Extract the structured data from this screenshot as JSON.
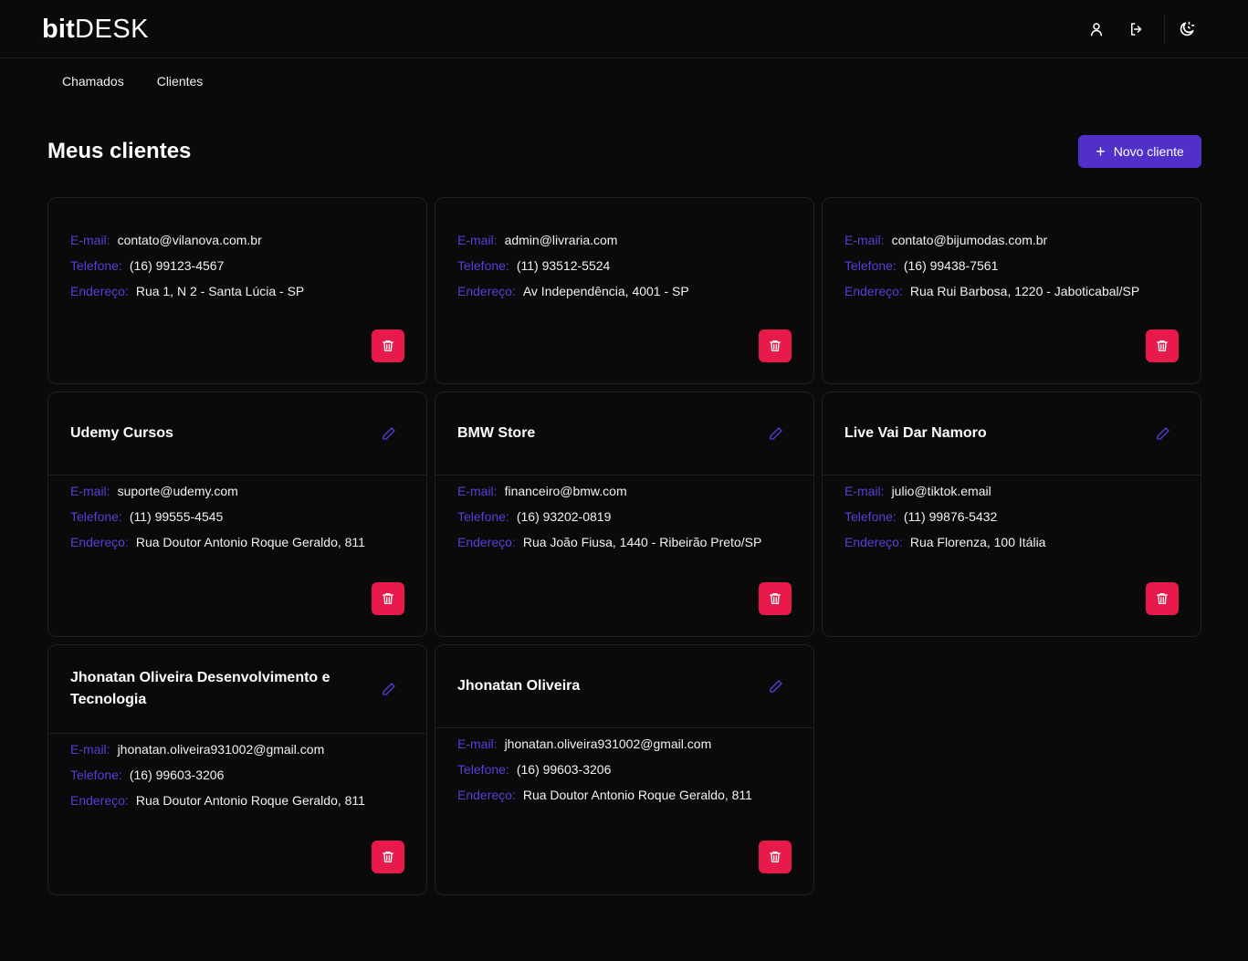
{
  "app": {
    "logo_bold": "bit",
    "logo_thin": "DESK"
  },
  "header_icons": [
    "user-icon",
    "logout-icon",
    "theme-toggle-icon"
  ],
  "nav": {
    "items": [
      "Chamados",
      "Clientes"
    ]
  },
  "page": {
    "title": "Meus clientes",
    "new_button": "Novo cliente"
  },
  "labels": {
    "email": "E-mail:",
    "phone": "Telefone:",
    "address": "Endereço:"
  },
  "clients": [
    {
      "name": "",
      "email": "contato@vilanova.com.br",
      "phone": "(16) 99123-4567",
      "address": "Rua 1, N 2 - Santa Lúcia - SP"
    },
    {
      "name": "",
      "email": "admin@livraria.com",
      "phone": "(11) 93512-5524",
      "address": "Av Independência, 4001 - SP"
    },
    {
      "name": "",
      "email": "contato@bijumodas.com.br",
      "phone": "(16) 99438-7561",
      "address": "Rua Rui Barbosa, 1220 - Jaboticabal/SP"
    },
    {
      "name": "Udemy Cursos",
      "email": "suporte@udemy.com",
      "phone": "(11) 99555-4545",
      "address": "Rua Doutor Antonio Roque Geraldo, 811"
    },
    {
      "name": "BMW Store",
      "email": "financeiro@bmw.com",
      "phone": "(16) 93202-0819",
      "address": "Rua João Fiusa, 1440 - Ribeirão Preto/SP"
    },
    {
      "name": "Live Vai Dar Namoro",
      "email": "julio@tiktok.email",
      "phone": "(11) 99876-5432",
      "address": "Rua Florenza, 100 Itália"
    },
    {
      "name": "Jhonatan Oliveira Desenvolvimento e Tecnologia",
      "email": "jhonatan.oliveira931002@gmail.com",
      "phone": "(16) 99603-3206",
      "address": "Rua Doutor Antonio Roque Geraldo, 811"
    },
    {
      "name": "Jhonatan Oliveira",
      "email": "jhonatan.oliveira931002@gmail.com",
      "phone": "(16) 99603-3206",
      "address": "Rua Doutor Antonio Roque Geraldo, 811"
    }
  ],
  "colors": {
    "background": "#0a0a0b",
    "accent": "#5130c9",
    "label": "#5b3cd6",
    "danger": "#e8194b",
    "border": "#202024"
  }
}
